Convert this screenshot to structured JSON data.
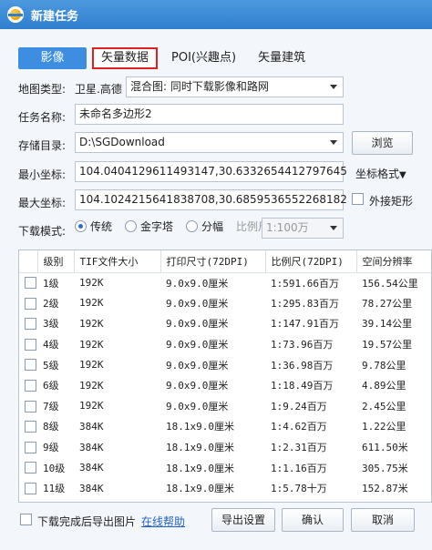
{
  "window": {
    "title": "新建任务"
  },
  "tabs": [
    {
      "label": "影像"
    },
    {
      "label": "矢量数据"
    },
    {
      "label": "POI(兴趣点)"
    },
    {
      "label": "矢量建筑"
    }
  ],
  "map_type": {
    "label": "地图类型:",
    "provider": "卫星.高德",
    "mode": "混合图: 同时下载影像和路网"
  },
  "task_name": {
    "label": "任务名称:",
    "value": "未命名多边形2"
  },
  "storage": {
    "label": "存储目录:",
    "value": "D:\\SGDownload",
    "browse_label": "浏览"
  },
  "min_coord": {
    "label": "最小坐标:",
    "value": "104.0404129611493147,30.6332654412797645",
    "format_label": "坐标格式"
  },
  "max_coord": {
    "label": "最大坐标:",
    "value": "104.1024215641838708,30.6859536552268182",
    "outer_rect_label": "外接矩形"
  },
  "download_mode": {
    "label": "下载模式:",
    "options": [
      "传统",
      "金字塔",
      "分幅"
    ],
    "selected": "传统",
    "scale_label": "比例尺:",
    "scale_value": "1:100万"
  },
  "table": {
    "headers": [
      "级别",
      "TIF文件大小",
      "打印尺寸(72DPI)",
      "比例尺(72DPI)",
      "空间分辨率"
    ],
    "rows": [
      [
        "1级",
        "192K",
        "9.0x9.0厘米",
        "1:591.66百万",
        "156.54公里"
      ],
      [
        "2级",
        "192K",
        "9.0x9.0厘米",
        "1:295.83百万",
        "78.27公里"
      ],
      [
        "3级",
        "192K",
        "9.0x9.0厘米",
        "1:147.91百万",
        "39.14公里"
      ],
      [
        "4级",
        "192K",
        "9.0x9.0厘米",
        "1:73.96百万",
        "19.57公里"
      ],
      [
        "5级",
        "192K",
        "9.0x9.0厘米",
        "1:36.98百万",
        "9.78公里"
      ],
      [
        "6级",
        "192K",
        "9.0x9.0厘米",
        "1:18.49百万",
        "4.89公里"
      ],
      [
        "7级",
        "192K",
        "9.0x9.0厘米",
        "1:9.24百万",
        "2.45公里"
      ],
      [
        "8级",
        "384K",
        "18.1x9.0厘米",
        "1:4.62百万",
        "1.22公里"
      ],
      [
        "9级",
        "384K",
        "18.1x9.0厘米",
        "1:2.31百万",
        "611.50米"
      ],
      [
        "10级",
        "384K",
        "18.1x9.0厘米",
        "1:1.16百万",
        "305.75米"
      ],
      [
        "11级",
        "384K",
        "18.1x9.0厘米",
        "1:5.78十万",
        "152.87米"
      ]
    ]
  },
  "footer": {
    "export_check_label": "下载完成后导出图片",
    "help_link": "在线帮助",
    "export_settings": "导出设置",
    "ok": "确认",
    "cancel": "取消"
  }
}
